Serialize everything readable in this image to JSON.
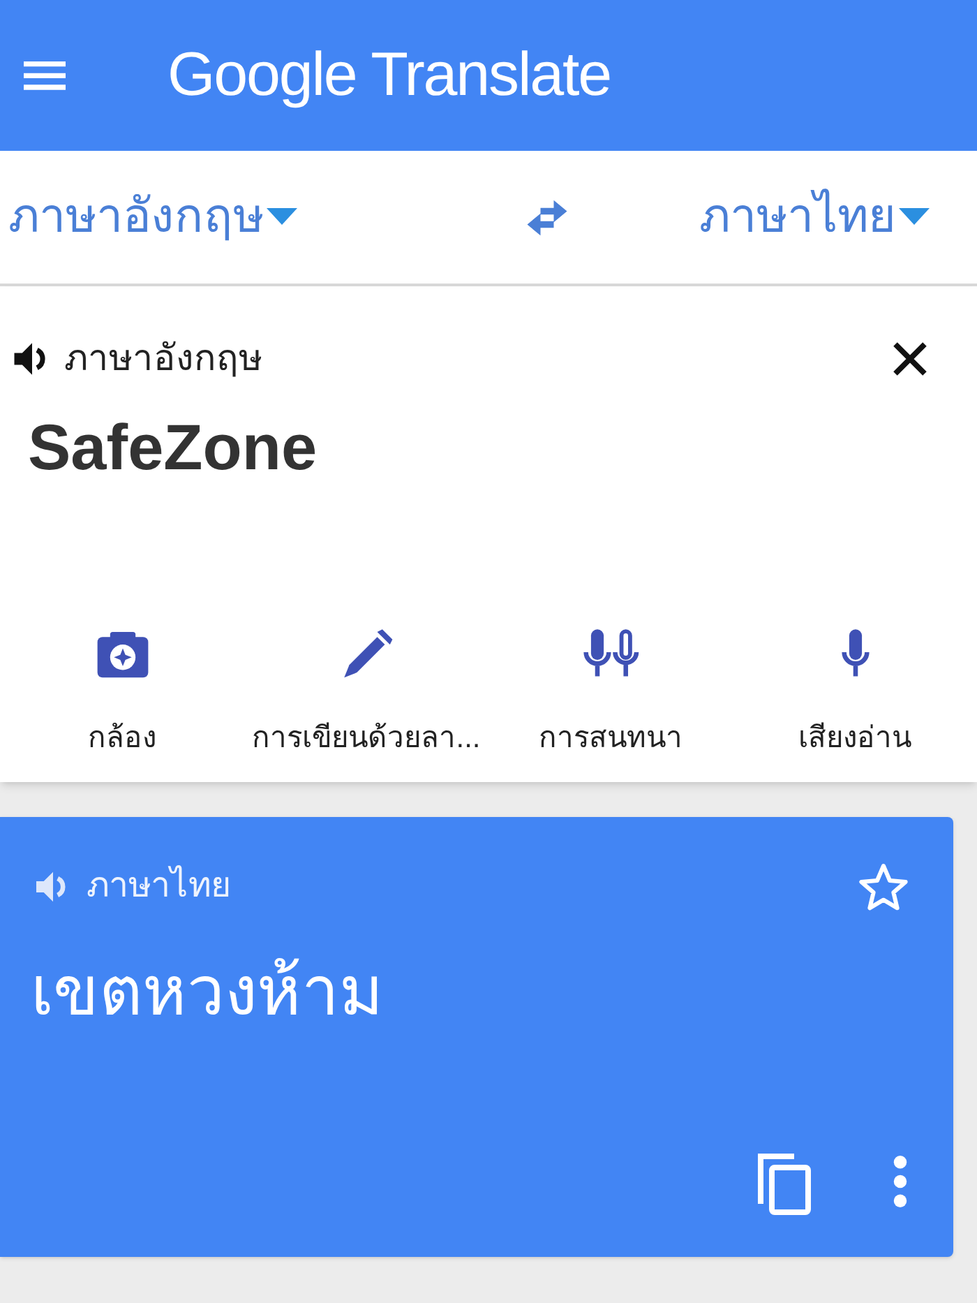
{
  "app_bar": {
    "title": "Google Translate"
  },
  "language_bar": {
    "source": "ภาษาอังกฤษ",
    "target": "ภาษาไทย"
  },
  "input_card": {
    "language": "ภาษาอังกฤษ",
    "text": "SafeZone",
    "tools": [
      {
        "kind": "camera",
        "label": "กล้อง"
      },
      {
        "kind": "handwriting",
        "label": "การเขียนด้วยลา..."
      },
      {
        "kind": "conversation",
        "label": "การสนทนา"
      },
      {
        "kind": "voice",
        "label": "เสียงอ่าน"
      }
    ]
  },
  "result_card": {
    "language": "ภาษาไทย",
    "text": "เขตหวงห้าม",
    "starred": false
  }
}
